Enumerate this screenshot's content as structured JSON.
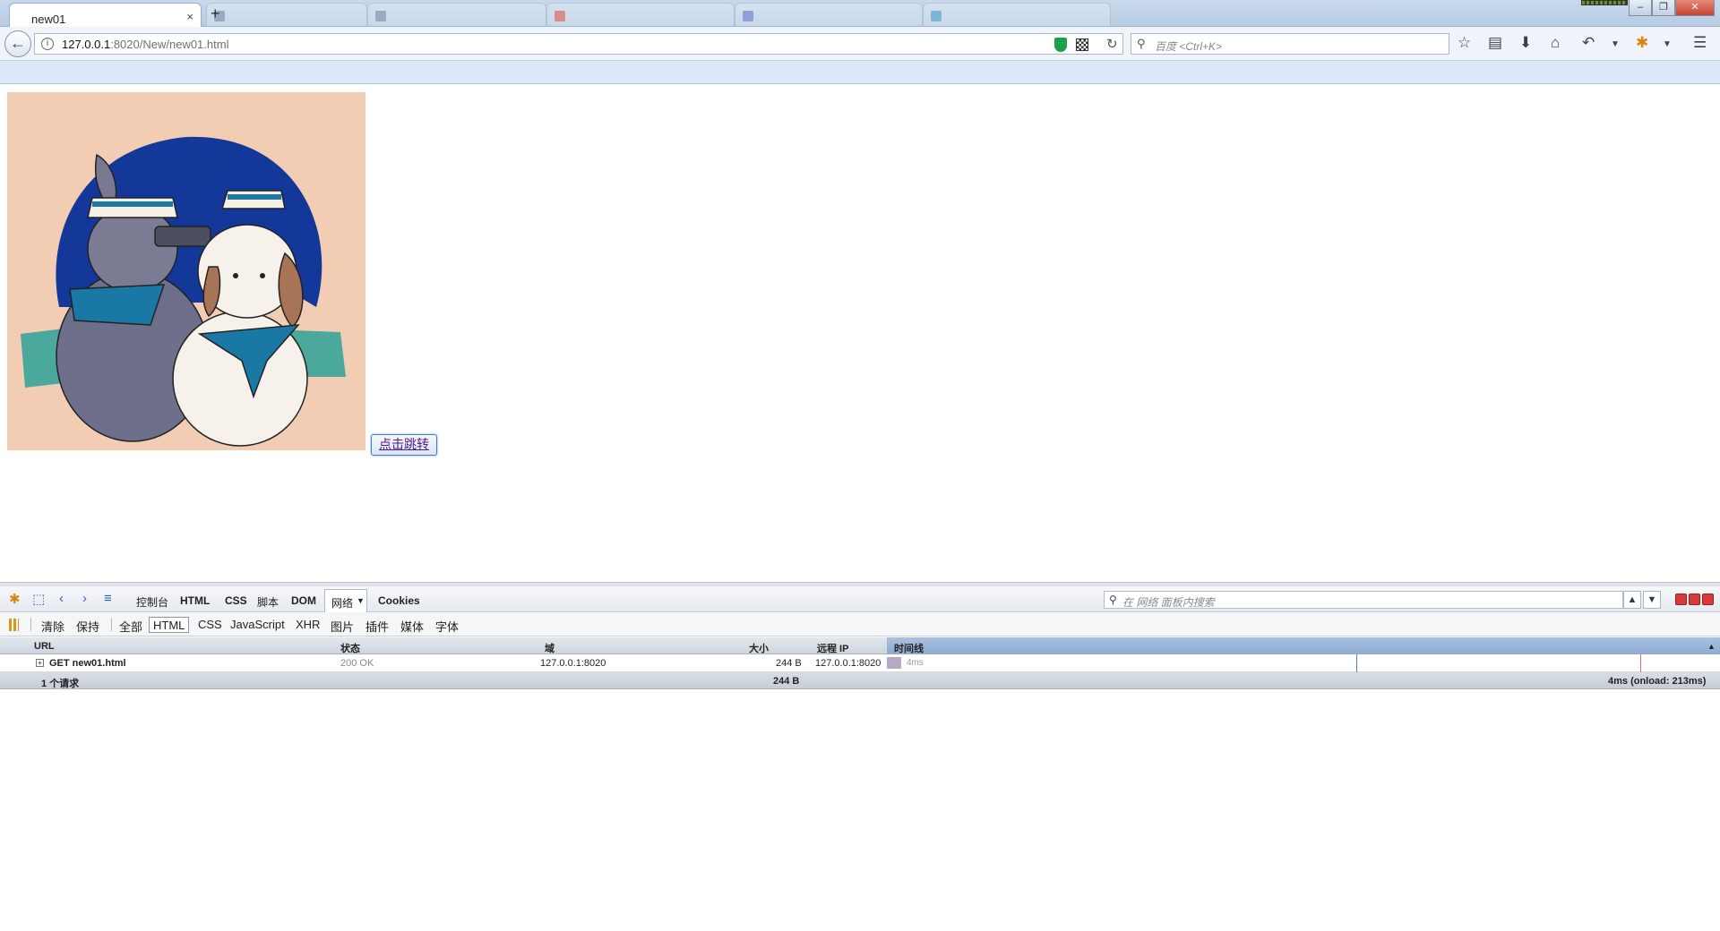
{
  "browser": {
    "active_tab_title": "new01",
    "new_tab_symbol": "+",
    "close_symbol": "×",
    "window_buttons": [
      "‒",
      "❐",
      "✕"
    ]
  },
  "navbar": {
    "url_host": "127.0.0.1",
    "url_rest": ":8020/New/new01.html",
    "search_placeholder": "百度 <Ctrl+K>"
  },
  "page": {
    "button_label": "点击跳转"
  },
  "firebug": {
    "tabs": [
      "控制台",
      "HTML",
      "CSS",
      "脚本",
      "DOM",
      "网络",
      "Cookies"
    ],
    "search_placeholder": "在 网络 面板内搜索",
    "filters": [
      "清除",
      "保持",
      "全部",
      "HTML",
      "CSS",
      "JavaScript",
      "XHR",
      "图片",
      "插件",
      "媒体",
      "字体"
    ],
    "columns": [
      "URL",
      "状态",
      "域",
      "大小",
      "远程 IP",
      "时间线"
    ],
    "request": {
      "url": "GET new01.html",
      "status": "200 OK",
      "domain": "127.0.0.1:8020",
      "size": "244 B",
      "remote_ip": "127.0.0.1:8020",
      "time": "4ms"
    },
    "summary": {
      "count": "1 个请求",
      "size": "244 B",
      "timing": "4ms (onload: 213ms)"
    }
  },
  "colors": {
    "tab_strip": "#c1d4ea",
    "bookmark_bar": "#dde9f8",
    "link_visited": "#551a8b",
    "timeline_header": "#9db6d8"
  }
}
